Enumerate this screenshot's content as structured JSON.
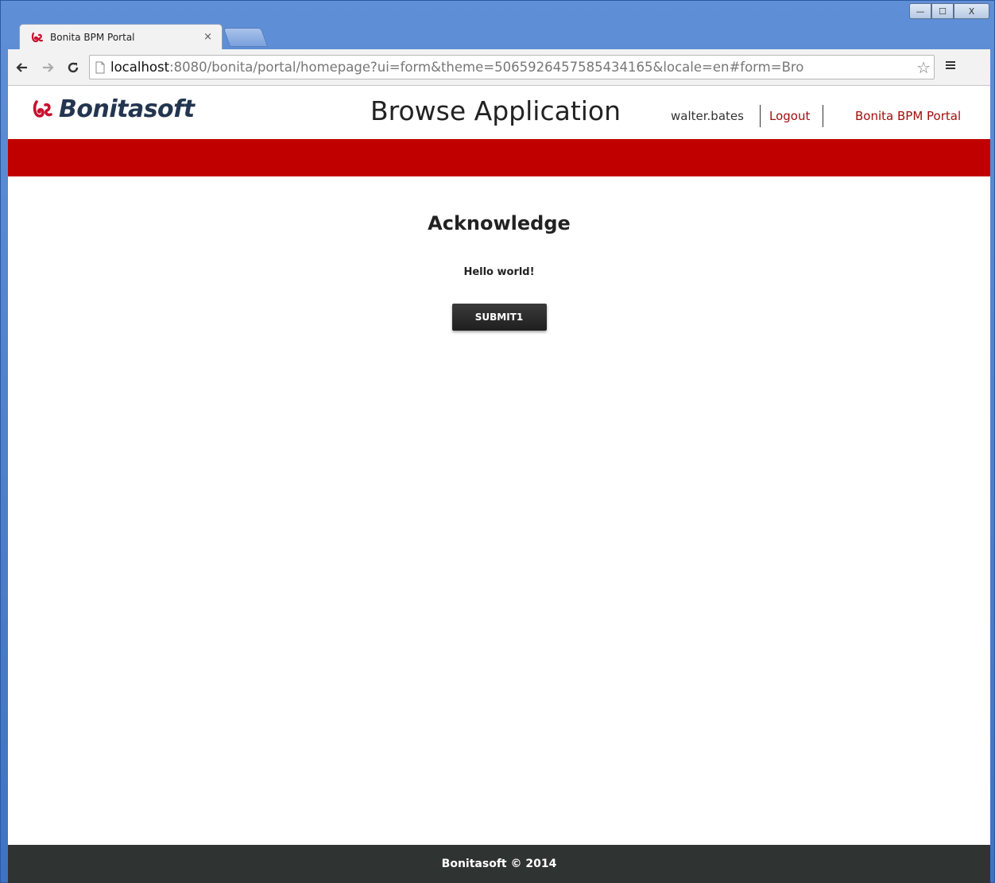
{
  "browser": {
    "tab_title": "Bonita BPM Portal",
    "tab_close": "×",
    "url_host": "localhost",
    "url_rest": ":8080/bonita/portal/homepage?ui=form&theme=5065926457585434165&locale=en#form=Bro",
    "window_controls": {
      "minimize": "—",
      "maximize": "☐",
      "close": "X"
    }
  },
  "header": {
    "logo_text": "Bonitasoft",
    "app_title": "Browse Application",
    "user_name": "walter.bates",
    "logout_label": "Logout",
    "portal_label": "Bonita BPM Portal"
  },
  "form": {
    "title": "Acknowledge",
    "message": "Hello world!",
    "submit_label": "SUBMIT1"
  },
  "footer": {
    "text": "Bonitasoft © 2014"
  },
  "colors": {
    "accent_red": "#c00000",
    "link_red": "#a30d0d",
    "logo_navy": "#23354f",
    "footer_bg": "#2f3331"
  },
  "icons": [
    "bonita-logo-icon",
    "back-arrow-icon",
    "forward-arrow-icon",
    "reload-icon",
    "page-icon",
    "star-icon",
    "menu-icon",
    "tab-close-icon"
  ]
}
